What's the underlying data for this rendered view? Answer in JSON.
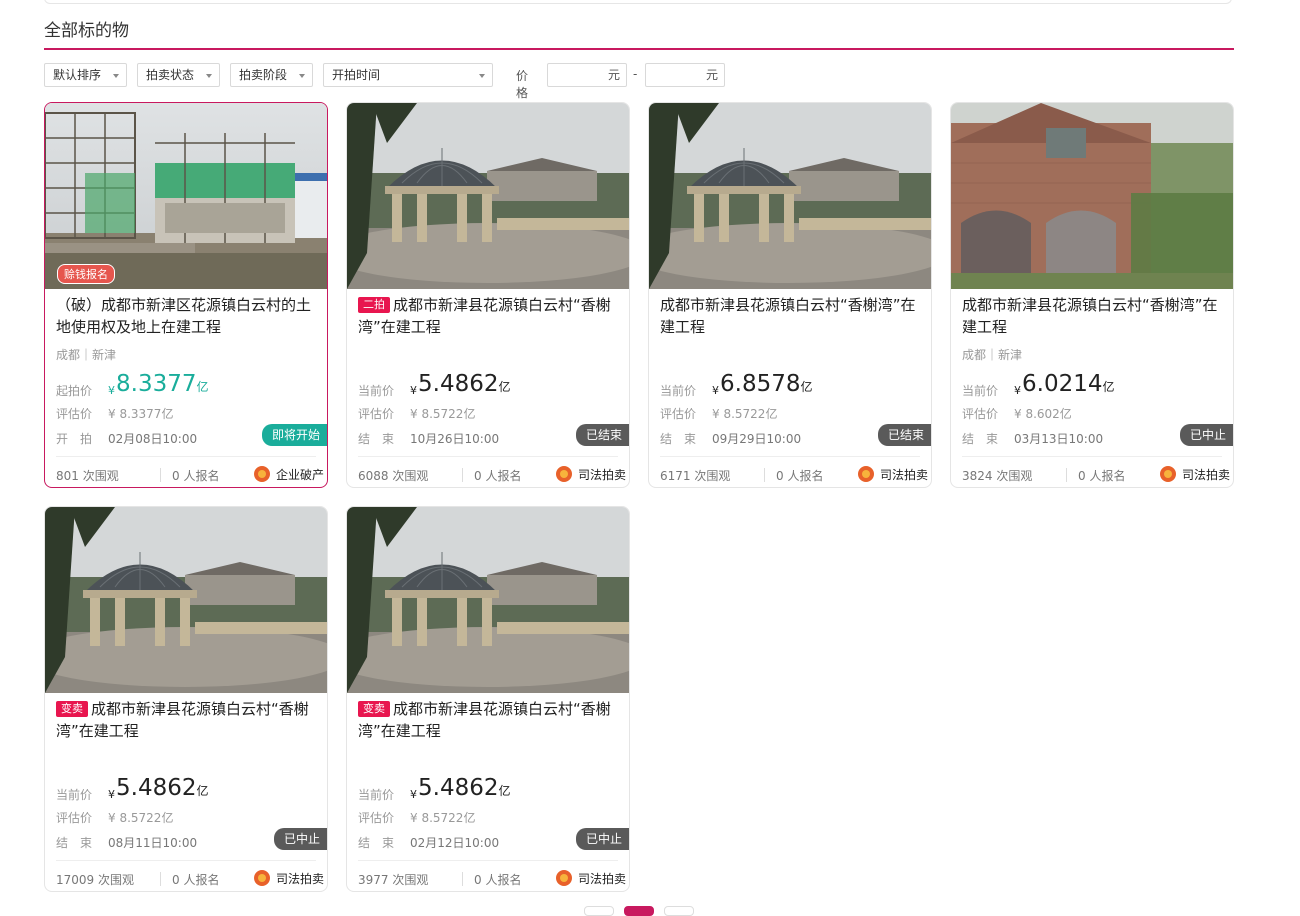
{
  "section": {
    "title": "全部标的物"
  },
  "filters": {
    "sort": "默认排序",
    "status": "拍卖状态",
    "stage": "拍卖阶段",
    "start_time": "开拍时间",
    "price_label": "价格",
    "price_min_unit": "元",
    "price_max_unit": "元",
    "dash": "-"
  },
  "cards": [
    {
      "pre_badge": "赊钱报名",
      "tag": "",
      "title": "（破）成都市新津区花源镇白云村的土地使用权及地上在建工程",
      "location": "成都｜新津",
      "price_label": "起拍价",
      "yen": "¥",
      "price": "8.3377",
      "unit": "亿",
      "eval_label": "评估价",
      "eval_value": "¥ 8.3377亿",
      "time_label": "开　拍",
      "time_value": "02月08日10:00",
      "status": "即将开始",
      "views": "801 次围观",
      "signups": "0 人报名",
      "type": "企业破产"
    },
    {
      "pre_badge": "",
      "tag": "二拍",
      "title": "成都市新津县花源镇白云村“香榭湾”在建工程",
      "location": "",
      "price_label": "当前价",
      "yen": "¥",
      "price": "5.4862",
      "unit": "亿",
      "eval_label": "评估价",
      "eval_value": "¥ 8.5722亿",
      "time_label": "结　束",
      "time_value": "10月26日10:00",
      "status": "已结束",
      "views": "6088 次围观",
      "signups": "0 人报名",
      "type": "司法拍卖"
    },
    {
      "pre_badge": "",
      "tag": "",
      "title": "成都市新津县花源镇白云村“香榭湾”在建工程",
      "location": "",
      "price_label": "当前价",
      "yen": "¥",
      "price": "6.8578",
      "unit": "亿",
      "eval_label": "评估价",
      "eval_value": "¥ 8.5722亿",
      "time_label": "结　束",
      "time_value": "09月29日10:00",
      "status": "已结束",
      "views": "6171 次围观",
      "signups": "0 人报名",
      "type": "司法拍卖"
    },
    {
      "pre_badge": "",
      "tag": "",
      "title": "成都市新津县花源镇白云村“香榭湾”在建工程",
      "location": "成都｜新津",
      "price_label": "当前价",
      "yen": "¥",
      "price": "6.0214",
      "unit": "亿",
      "eval_label": "评估价",
      "eval_value": "¥ 8.602亿",
      "time_label": "结　束",
      "time_value": "03月13日10:00",
      "status": "已中止",
      "views": "3824 次围观",
      "signups": "0 人报名",
      "type": "司法拍卖"
    },
    {
      "pre_badge": "",
      "tag": "变卖",
      "title": "成都市新津县花源镇白云村“香榭湾”在建工程",
      "location": "",
      "price_label": "当前价",
      "yen": "¥",
      "price": "5.4862",
      "unit": "亿",
      "eval_label": "评估价",
      "eval_value": "¥ 8.5722亿",
      "time_label": "结　束",
      "time_value": "08月11日10:00",
      "status": "已中止",
      "views": "17009 次围观",
      "signups": "0 人报名",
      "type": "司法拍卖"
    },
    {
      "pre_badge": "",
      "tag": "变卖",
      "title": "成都市新津县花源镇白云村“香榭湾”在建工程",
      "location": "",
      "price_label": "当前价",
      "yen": "¥",
      "price": "5.4862",
      "unit": "亿",
      "eval_label": "评估价",
      "eval_value": "¥ 8.5722亿",
      "time_label": "结　束",
      "time_value": "02月12日10:00",
      "status": "已中止",
      "views": "3977 次围观",
      "signups": "0 人报名",
      "type": "司法拍卖"
    }
  ]
}
